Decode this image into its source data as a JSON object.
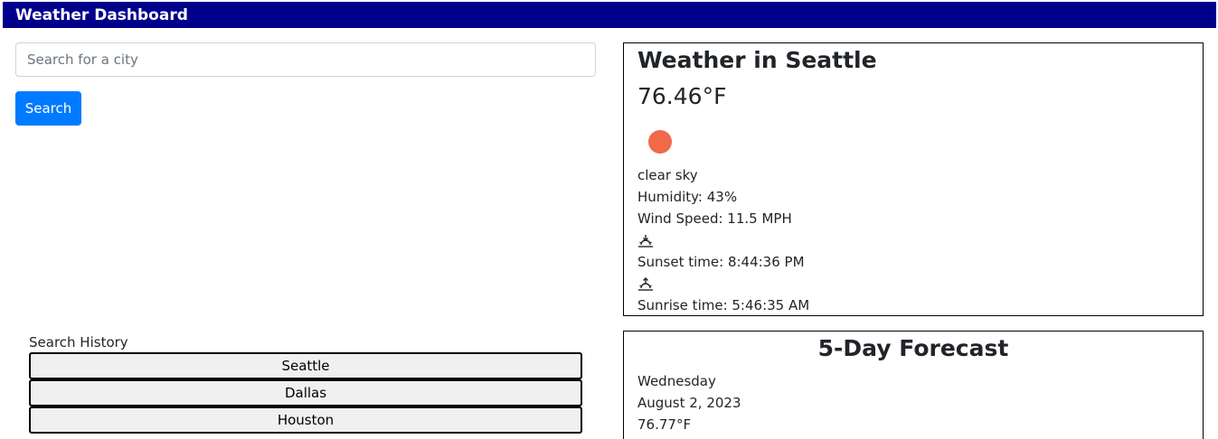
{
  "header": {
    "title": "Weather Dashboard",
    "color": "#00008b"
  },
  "search": {
    "placeholder": "Search for a city",
    "value": "",
    "button_label": "Search",
    "button_color": "#007bff"
  },
  "history": {
    "title": "Search History",
    "items": [
      "Seattle",
      "Dallas",
      "Houston"
    ]
  },
  "current": {
    "title": "Weather in Seattle",
    "temperature": "76.46°F",
    "icon": "sun-icon",
    "icon_color": "#f06a4a",
    "description": "clear sky",
    "humidity": "Humidity: 43%",
    "wind_speed": "Wind Speed: 11.5 MPH",
    "sunset_icon": "sunset-icon",
    "sunset": "Sunset time: 8:44:36 PM",
    "sunrise_icon": "sunrise-icon",
    "sunrise": "Sunrise time: 5:46:35 AM"
  },
  "forecast": {
    "title": "5-Day Forecast",
    "days": [
      {
        "weekday": "Wednesday",
        "date": "August 2, 2023",
        "temperature": "76.77°F"
      }
    ]
  }
}
